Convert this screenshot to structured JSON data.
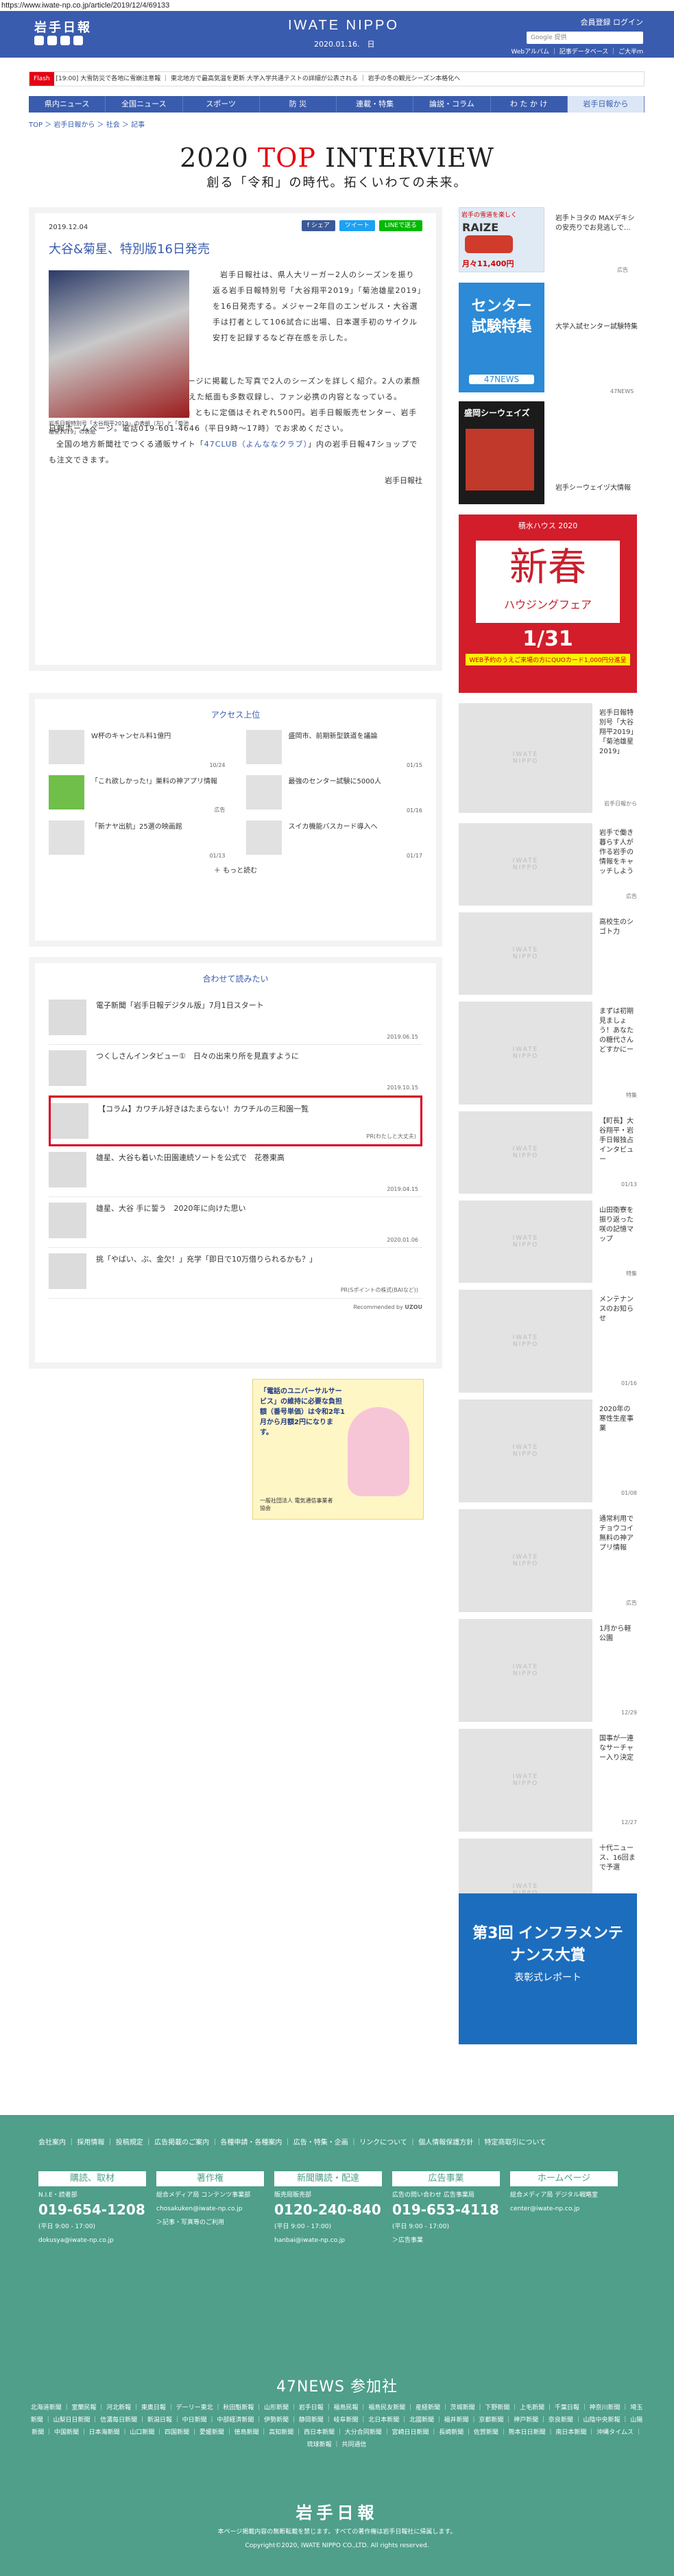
{
  "url": "https://www.iwate-np.co.jp/article/2019/12/4/69133",
  "header": {
    "logo": "岩手日報",
    "brand": "IWATE NIPPO",
    "date": "2020.01.16.　日",
    "links": "会員登録 ログイン",
    "search_placeholder": "Google 提供",
    "sub": "Webアルバム ｜ 記事データベース ｜ ご大半ｍ"
  },
  "ticker": {
    "flash": "Flash",
    "text": "[19:00] 大雪防災で各地に雪崩注意報 ｜ 東北地方で最高気温を更新 大学入学共通テストの詳細が公表される ｜ 岩手の冬の観光シーズン本格化へ"
  },
  "nav": [
    "県内ニュース",
    "全国ニュース",
    "スポーツ",
    "防 災",
    "連載・特集",
    "論説・コラム",
    "わ た か け",
    "岩手日報から"
  ],
  "breadcrumb": "TOP ＞ 岩手日報から ＞ 社会 ＞ 記事",
  "banner": {
    "pre": "2020 ",
    "red": "TOP",
    "post": " INTERVIEW",
    "sub": "創る「令和」の時代。拓くいわての未来。"
  },
  "article": {
    "date": "2019.12.04",
    "share": [
      "f シェア",
      "ツイート",
      "LINEで送る"
    ],
    "title": "大谷&菊星、特別版16日発売",
    "caption": "岩手日報特別号「大谷翔平2019」の表紙（左）と「菊池雄星2019」の表紙",
    "p1": "岩手日報社は、県人大リーガー2人のシーズンを振り返る岩手日報特別号「大谷翔平2019」「菊池雄星2019」を16日発売する。メジャー2年目のエンゼルス・大谷選手は打者として106試合に出場、日本選手初のサイクル安打を記録するなど存在感を示した。",
    "p2": "特別号は、本紙と岩手日報ホームページに掲載した写真で2人のシーズンを詳しく紹介。2人の素顔に迫るロングインタビューや活躍を伝えた紙面も多数収録し、ファン必携の内容となっている。",
    "p3": "「大谷翔平2019」「菊池雄星2019」ともに定価はそれぞれ500円。岩手日報販売センター、岩手日報ホームページ。電話019-601-4646（平日9時～17時）でお求めください。",
    "p4_pre": "全国の地方新聞社でつくる通販サイト「",
    "p4_link": "47CLUB（よんななクラブ）",
    "p4_post": "」内の岩手日報47ショップでも注文できます。",
    "sign": "岩手日報社"
  },
  "ranking": {
    "title": "アクセス上位",
    "items": [
      {
        "t": "W杯のキャンセル料1億円",
        "d": "10/24"
      },
      {
        "t": "盛岡市、前期新型鉄道を議論",
        "d": "01/15"
      },
      {
        "t": "「これ欲しかった!」巣料の神アプリ情報",
        "d": "広告"
      },
      {
        "t": "最強のセンター試験に5000人",
        "d": "01/16"
      },
      {
        "t": "「新ナヤ出航」25選の映画館",
        "d": "01/13"
      },
      {
        "t": "スイカ機能バスカード導入へ",
        "d": "01/17"
      }
    ],
    "more": "もっと読む"
  },
  "related": {
    "title": "合わせて読みたい",
    "items": [
      {
        "t": "電子新聞「岩手日報デジタル版」7月1日スタート",
        "d": "2019.06.15"
      },
      {
        "t": "つくしさんインタビュー①　日々の出来り所を見直すように",
        "d": "2019.10.15"
      },
      {
        "t": "【コラム】カワチル好きはたまらない！カワチルの三和園一覧",
        "d": "PR(わたしと大丈夫)"
      },
      {
        "t": "雄星、大谷も着いた田園連続ソートを公式で　花巻東高",
        "d": "2019.04.15"
      },
      {
        "t": "雄星、大谷 手に誓う　2020年に向けた思い",
        "d": "2020.01.06"
      },
      {
        "t": "挑「やばい、ぶ、金欠！」充学「即日で10万借りられるかも？」",
        "d": "PR(Sポイントの株式(BAIなど))"
      }
    ],
    "credit": "Recommended by",
    "credit_brand": "UZOU"
  },
  "ad_usf": {
    "title": "「電話のユニバーサルサービス」の維持に必要な負担額（番号単価）は令和2年1月から月額2円になります。",
    "body": "一般社団法人 電気通信事業者協会"
  },
  "side": {
    "ad1": {
      "head": "岩手の雪道を楽しく",
      "model": "RAIZE",
      "price": "月々11,400円",
      "note": "広告"
    },
    "ad1_text": "岩手トヨタの MAXデキシの安売りでお見逃しで…",
    "ad1_tag": "広告",
    "exam": {
      "head": "センター試験特集",
      "logo": "47NEWS",
      "txt": "大学入試センター試験特集",
      "tag": "47NEWS"
    },
    "ladies": {
      "head": "盛岡シーウェイズ",
      "txt": "岩手シーウェイヅ大情報",
      "tag": "特集"
    },
    "housing": {
      "head": "積水ハウス 2020",
      "big": "新春",
      "sub": "ハウジングフェア",
      "date": "1/31",
      "note": "WEB予約のうえご来場の方にQUOカード1,000円分進呈"
    },
    "list": [
      {
        "t": "岩手日報特別号「大谷翔平2019」「菊池雄星2019」",
        "d": "岩手日報から",
        "h": 160
      },
      {
        "t": "岩手で働き暮らす人が作る岩手の情報をキャッチしよう",
        "d": "広告",
        "h": 120
      },
      {
        "t": "高校生のシゴト力",
        "d": "",
        "h": 120
      },
      {
        "t": "まずは初期見ましょう！あなたの糖代さんどすかにー",
        "d": "特集",
        "h": 150
      },
      {
        "t": "【町長】大谷翔平・岩手日報独占インタビュー",
        "d": "01/13",
        "h": 120
      },
      {
        "t": "山田衛寮を振り返った咲の記憶マップ",
        "d": "特集",
        "h": 120
      },
      {
        "t": "メンテナンスのお知らせ",
        "d": "01/16",
        "h": 150
      },
      {
        "t": "2020年の寒性生産事業",
        "d": "01/08",
        "h": 150
      },
      {
        "t": "通常利用でチョウコイ無料の神アプリ情報",
        "d": "広告",
        "h": 150
      },
      {
        "t": "1月から軽公園",
        "d": "12/29",
        "h": 150
      },
      {
        "t": "国事が一連なサーチャー入り決定",
        "d": "12/27",
        "h": 150
      },
      {
        "t": "十代ニュース、16回まで予選",
        "d": "12/21",
        "h": 150
      }
    ],
    "infra": {
      "head": "第3回 インフラメンテナンス大賞",
      "sub": "表彰式レポート"
    }
  },
  "footer": {
    "links": "会社案内 ｜ 採用情報 ｜ 投稿規定 ｜ 広告掲載のご案内 ｜ 各種申請・各種案内 ｜ 広告・特集・企画 ｜ リンクについて ｜ 個人情報保護方針 ｜ 特定商取引について",
    "cols": [
      {
        "h": "購読、取材",
        "b1": "N.I.E・読者部",
        "tel": "019-654-1208",
        "b2": "(平日 9:00 - 17:00)",
        "b3": "dokusya@iwate-np.co.jp"
      },
      {
        "h": "著作権",
        "b1": "総合メディア局 コンテンツ事業部",
        "tel": "",
        "b2": "chosakuken@iwate-np.co.jp",
        "b3": "＞記事・写真等のご利用"
      },
      {
        "h": "新聞購読・配達",
        "b1": "販売局販売部",
        "tel": "0120-240-840",
        "b2": "(平日 9:00 - 17:00)",
        "b3": "hanbai@iwate-np.co.jp"
      },
      {
        "h": "広告事業",
        "b1": "広告の問い合わせ 広告事業局",
        "tel": "019-653-4118",
        "b2": "(平日 9:00 - 17:00)",
        "b3": "＞広告事業"
      },
      {
        "h": "ホームページ",
        "b1": "総合メディア局 デジタル戦略室",
        "tel": "",
        "b2": "center@iwate-np.co.jp",
        "b3": ""
      }
    ],
    "n47": "47NEWS 参加社",
    "news": "北海道新聞 ｜ 室蘭民報 ｜ 河北新報 ｜ 東奥日報 ｜ デーリー東北 ｜ 秋田魁新報 ｜ 山形新聞 ｜ 岩手日報 ｜ 福島民報 ｜ 福島民友新聞 ｜ 産経新聞 ｜ 茨城新聞 ｜ 下野新聞 ｜ 上毛新聞 ｜ 千葉日報 ｜ 神奈川新聞 ｜ 埼玉新聞 ｜ 山梨日日新聞 ｜ 信濃毎日新聞 ｜ 新潟日報 ｜ 中日新聞 ｜ 中部経済新聞 ｜ 伊勢新聞 ｜ 静岡新聞 ｜ 岐阜新聞 ｜ 北日本新聞 ｜ 北國新聞 ｜ 福井新聞 ｜ 京都新聞 ｜ 神戸新聞 ｜ 奈良新聞 ｜ 山陰中央新報 ｜ 山陽新聞 ｜ 中国新聞 ｜ 日本海新聞 ｜ 山口新聞 ｜ 四国新聞 ｜ 愛媛新聞 ｜ 徳島新聞 ｜ 高知新聞 ｜ 西日本新聞 ｜ 大分合同新聞 ｜ 宮崎日日新聞 ｜ 長崎新聞 ｜ 佐賀新聞 ｜ 熊本日日新聞 ｜ 南日本新聞 ｜ 沖縄タイムス ｜ 琉球新報 ｜ 共同通信",
    "logo": "岩手日報",
    "c1": "本ページ掲載内容の無断転載を禁じます。すべての著作権は岩手日報社に帰属します。",
    "c2": "Copyright©2020, IWATE NIPPO CO.,LTD. All rights reserved."
  }
}
